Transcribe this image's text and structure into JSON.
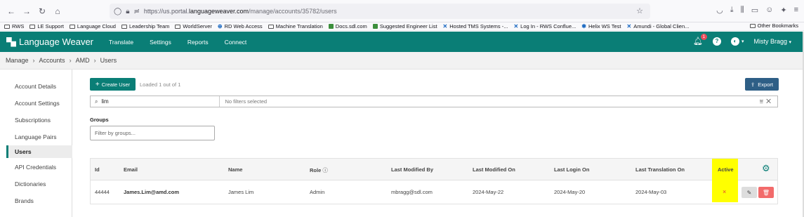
{
  "browser": {
    "url_prefix": "https://us.portal.",
    "url_host": "languageweaver.com",
    "url_path": "/manage/accounts/35782/users",
    "bookmarks": [
      "RWS",
      "LE Support",
      "Language Cloud",
      "Leadership Team",
      "WorldServer",
      "RD Web Access",
      "Machine Translation",
      "Docs.sdl.com",
      "Suggested Engineer List",
      "Hosted TMS Systems -...",
      "Log In - RWS Conflue...",
      "Helix WS Test",
      "Amundi - Global Clien..."
    ],
    "other_bookmarks": "Other Bookmarks"
  },
  "header": {
    "brand": "Language Weaver",
    "menu": [
      "Translate",
      "Settings",
      "Reports",
      "Connect"
    ],
    "notification_count": "1",
    "user": "Misty Bragg"
  },
  "breadcrumb": [
    "Manage",
    "Accounts",
    "AMD",
    "Users"
  ],
  "sidebar": {
    "items": [
      "Account Details",
      "Account Settings",
      "Subscriptions",
      "Language Pairs",
      "Users",
      "API Credentials",
      "Dictionaries",
      "Brands"
    ],
    "active": "Users"
  },
  "toolbar": {
    "create_label": "Create User",
    "loaded_text": "Loaded 1 out of 1",
    "export_label": "Export"
  },
  "search": {
    "value": "lim",
    "filters_placeholder": "No filters selected"
  },
  "groups": {
    "label": "Groups",
    "placeholder": "Filter by groups..."
  },
  "table": {
    "columns": [
      "Id",
      "Email",
      "Name",
      "Role",
      "Last Modified By",
      "Last Modified On",
      "Last Login On",
      "Last Translation On",
      "Active"
    ],
    "rows": [
      {
        "id": "44444",
        "email": "James.Lim@amd.com",
        "name": "James Lim",
        "role": "Admin",
        "last_modified_by": "mbragg@sdl.com",
        "last_modified_on": "2024-May-22",
        "last_login_on": "2024-May-20",
        "last_translation_on": "2024-May-03",
        "active": "×"
      }
    ]
  },
  "colors": {
    "brand_teal": "#0a7e76",
    "export_blue": "#2e5f86",
    "highlight": "#ffff00",
    "delete_red": "#f26b6b"
  }
}
